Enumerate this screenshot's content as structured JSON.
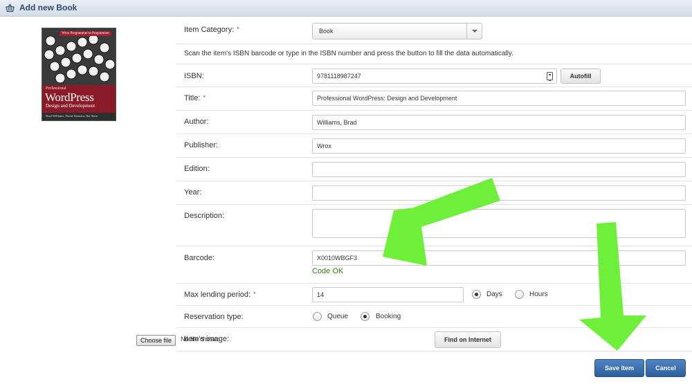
{
  "window": {
    "title": "Add new Book"
  },
  "cover": {
    "series": "Wrox Programmer to Programmer",
    "prefix": "Professional",
    "title": "WordPress",
    "subtitle": "Design and Development",
    "authors": "Brad Williams, David Damstra, Hal Stern"
  },
  "form": {
    "category": {
      "label": "Item Category:",
      "value": "Book"
    },
    "scan_hint": "Scan the item's ISBN barcode or type in the ISBN number and press the button to fill the data automatically.",
    "isbn": {
      "label": "ISBN:",
      "value": "9781118987247",
      "autofill": "Autofill"
    },
    "title": {
      "label": "Title:",
      "value": "Professional WordPress: Design and Development"
    },
    "author": {
      "label": "Author:",
      "value": "Williams, Brad"
    },
    "publisher": {
      "label": "Publisher:",
      "value": "Wrox"
    },
    "edition": {
      "label": "Edition:",
      "value": ""
    },
    "year": {
      "label": "Year:",
      "value": ""
    },
    "description": {
      "label": "Description:",
      "value": ""
    },
    "barcode": {
      "label": "Barcode:",
      "value": "X0010WBGF3",
      "status": "Code OK"
    },
    "lending": {
      "label": "Max lending period:",
      "value": "14",
      "unit_days": "Days",
      "unit_hours": "Hours",
      "selected": "Days"
    },
    "reservation": {
      "label": "Reservation type:",
      "queue": "Queue",
      "booking": "Booking",
      "selected": "Booking"
    },
    "image": {
      "label": "Item's image:",
      "choose": "Choose file",
      "nofile": "No file chosen",
      "find": "Find on Internet"
    }
  },
  "actions": {
    "save": "Save Item",
    "cancel": "Cancel"
  },
  "required_mark": "*",
  "colors": {
    "arrow": "#6ef03a",
    "primary_button": "#3a6fae",
    "ok_text": "#2a7d1a",
    "required": "#d43030"
  }
}
